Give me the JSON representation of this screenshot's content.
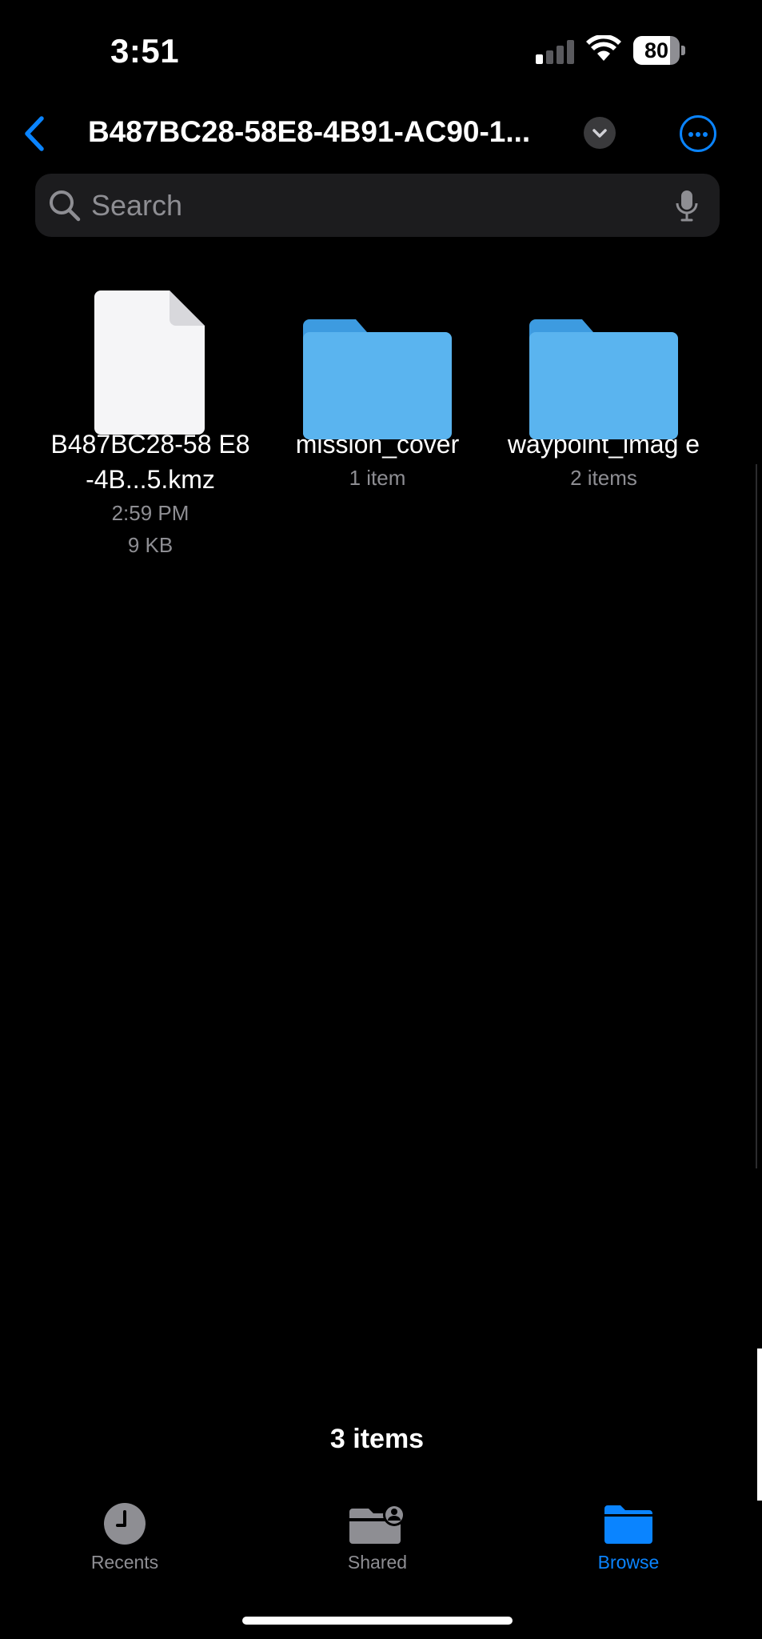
{
  "status_bar": {
    "time": "3:51",
    "battery_level": "80",
    "battery_fraction": 0.8
  },
  "nav": {
    "title": "B487BC28-58E8-4B91-AC90-1...",
    "back_icon": "chevron-left-icon",
    "menu_icon": "chevron-down-icon",
    "more_icon": "ellipsis-circle-icon",
    "accent_color": "#0a84ff"
  },
  "search": {
    "placeholder": "Search",
    "value": ""
  },
  "items": [
    {
      "kind": "file",
      "name": "B487BC28-58 E8-4B...5.kmz",
      "time": "2:59 PM",
      "size": "9 KB"
    },
    {
      "kind": "folder",
      "name": "mission_cover",
      "count": "1 item"
    },
    {
      "kind": "folder",
      "name": "waypoint_imag e",
      "count": "2 items"
    }
  ],
  "footer": {
    "items_count": "3 items"
  },
  "tabs": [
    {
      "label": "Recents",
      "icon": "clock-icon",
      "active": false
    },
    {
      "label": "Shared",
      "icon": "shared-folder-icon",
      "active": false
    },
    {
      "label": "Browse",
      "icon": "folder-icon",
      "active": true
    }
  ],
  "colors": {
    "background": "#000000",
    "folder": "#5ab4ef",
    "secondary_text": "#8e8e93"
  }
}
